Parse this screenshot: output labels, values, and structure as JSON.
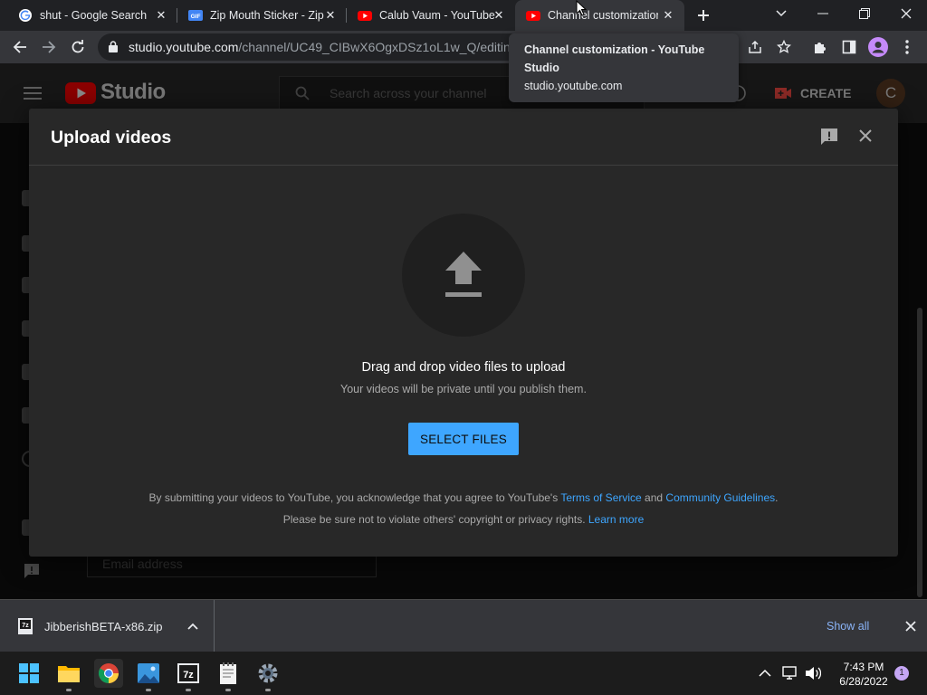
{
  "browser": {
    "tabs": [
      {
        "title": "shut - Google Search",
        "icon": "google-icon"
      },
      {
        "title": "Zip Mouth Sticker - Zip",
        "icon": "gif-icon"
      },
      {
        "title": "Calub Vaum - YouTube",
        "icon": "youtube-icon"
      },
      {
        "title": "Channel customization",
        "icon": "youtube-icon"
      }
    ],
    "url_main": "studio.youtube.com",
    "url_rest": "/channel/UC49_CIBwX6OgxDSz1oL1w_Q/editing"
  },
  "tooltip": {
    "title": "Channel customization - YouTube Studio",
    "url": "studio.youtube.com"
  },
  "studio": {
    "logo_text": "Studio",
    "search_placeholder": "Search across your channel",
    "create_label": "CREATE",
    "avatar_letter": "C",
    "email_placeholder": "Email address"
  },
  "upload_modal": {
    "title": "Upload videos",
    "drag_title": "Drag and drop video files to upload",
    "drag_subtitle": "Your videos will be private until you publish them.",
    "select_button": "SELECT FILES",
    "legal_line1_prefix": "By submitting your videos to YouTube, you acknowledge that you agree to YouTube's ",
    "terms_link": "Terms of Service",
    "legal_and": " and ",
    "guidelines_link": "Community Guidelines",
    "legal_period": ".",
    "legal_line2_prefix": "Please be sure not to violate others' copyright or privacy rights. ",
    "learn_more_link": "Learn more"
  },
  "download_bar": {
    "filename": "JibberishBETA-x86.zip",
    "show_all": "Show all"
  },
  "taskbar": {
    "apps": [
      "start-icon",
      "file-explorer-icon",
      "chrome-icon",
      "photos-icon",
      "7zip-icon",
      "notepad-icon",
      "settings-icon"
    ],
    "time": "7:43 PM",
    "date": "6/28/2022",
    "notification_count": "1"
  },
  "colors": {
    "accent_blue": "#3ea6ff",
    "youtube_red": "#ff0000",
    "modal_bg": "#282828"
  }
}
